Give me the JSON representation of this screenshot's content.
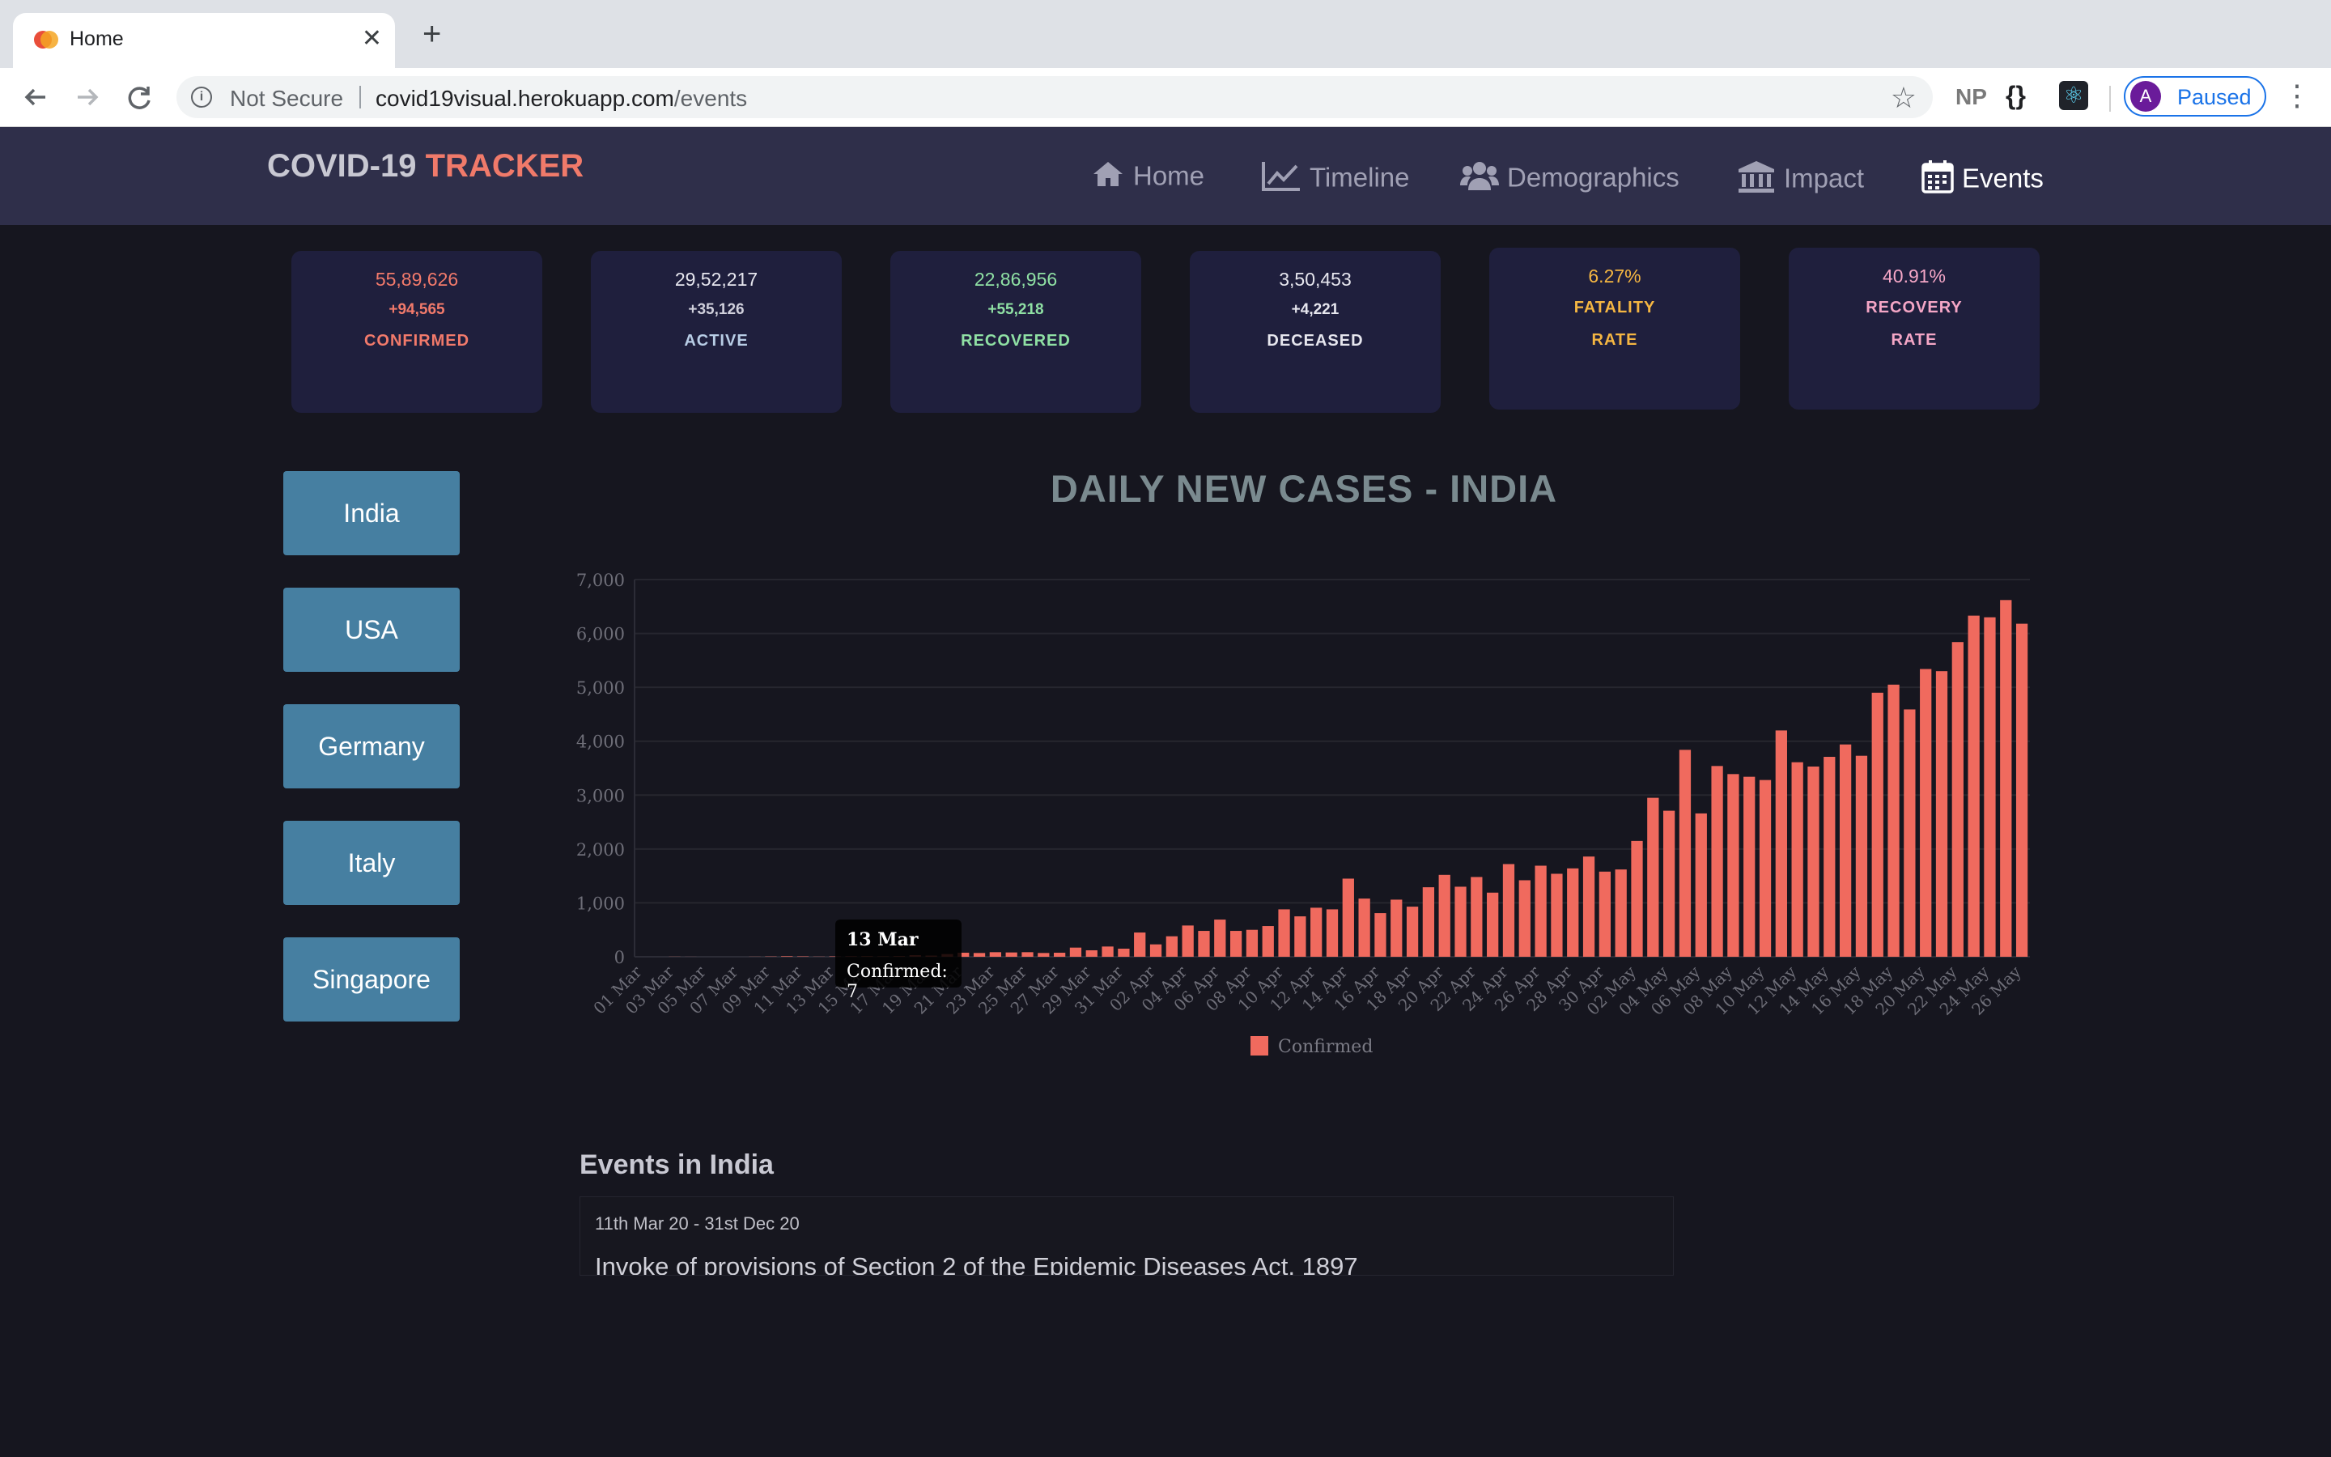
{
  "browser": {
    "tab_title": "Home",
    "new_tab_symbol": "+",
    "close_symbol": "✕",
    "security_label": "Not Secure",
    "url_host": "covid19visual.herokuapp.com",
    "url_path": "/events",
    "extensions": {
      "np": "NP",
      "braces": "{}"
    },
    "profile": {
      "initial": "A",
      "status": "Paused"
    }
  },
  "app": {
    "brand_main": "COVID-19",
    "brand_accent": "TRACKER",
    "nav": [
      {
        "label": "Home",
        "icon": "home-icon"
      },
      {
        "label": "Timeline",
        "icon": "line-chart-icon"
      },
      {
        "label": "Demographics",
        "icon": "users-icon"
      },
      {
        "label": "Impact",
        "icon": "institution-icon"
      },
      {
        "label": "Events",
        "icon": "calendar-icon",
        "active": true
      }
    ]
  },
  "stats": [
    {
      "value": "55,89,626",
      "delta": "+94,565",
      "label": "CONFIRMED",
      "color": "#f27a6b"
    },
    {
      "value": "29,52,217",
      "delta": "+35,126",
      "label": "ACTIVE",
      "color": "#a9c6e6"
    },
    {
      "value": "22,86,956",
      "delta": "+55,218",
      "label": "RECOVERED",
      "color": "#8fe0a4"
    },
    {
      "value": "3,50,453",
      "delta": "+4,221",
      "label": "DECEASED",
      "color": "#e0e0e8"
    },
    {
      "value": "6.27%",
      "label_line1": "FATALITY",
      "label_line2": "RATE",
      "color": "#f5b642"
    },
    {
      "value": "40.91%",
      "label_line1": "RECOVERY",
      "label_line2": "RATE",
      "color": "#f4a6c6"
    }
  ],
  "countries": [
    "India",
    "USA",
    "Germany",
    "Italy",
    "Singapore"
  ],
  "chart": {
    "title": "DAILY NEW CASES - INDIA",
    "tooltip_title": "13 Mar",
    "tooltip_body": "Confirmed: 7"
  },
  "chart_data": {
    "type": "bar",
    "title": "DAILY NEW CASES - INDIA",
    "xlabel": "",
    "ylabel": "",
    "ylim": [
      0,
      7000
    ],
    "yticks": [
      "0",
      "1,000",
      "2,000",
      "3,000",
      "4,000",
      "5,000",
      "6,000",
      "7,000"
    ],
    "grid": true,
    "legend": "bottom",
    "bar_color": "#f06a5e",
    "categories": [
      "01 Mar",
      "02 Mar",
      "03 Mar",
      "04 Mar",
      "05 Mar",
      "06 Mar",
      "07 Mar",
      "08 Mar",
      "09 Mar",
      "10 Mar",
      "11 Mar",
      "12 Mar",
      "13 Mar",
      "14 Mar",
      "15 Mar",
      "16 Mar",
      "17 Mar",
      "18 Mar",
      "19 Mar",
      "20 Mar",
      "21 Mar",
      "22 Mar",
      "23 Mar",
      "24 Mar",
      "25 Mar",
      "26 Mar",
      "27 Mar",
      "28 Mar",
      "29 Mar",
      "30 Mar",
      "31 Mar",
      "01 Apr",
      "02 Apr",
      "03 Apr",
      "04 Apr",
      "05 Apr",
      "06 Apr",
      "07 Apr",
      "08 Apr",
      "09 Apr",
      "10 Apr",
      "11 Apr",
      "12 Apr",
      "13 Apr",
      "14 Apr",
      "15 Apr",
      "16 Apr",
      "17 Apr",
      "18 Apr",
      "19 Apr",
      "20 Apr",
      "21 Apr",
      "22 Apr",
      "23 Apr",
      "24 Apr",
      "25 Apr",
      "26 Apr",
      "27 Apr",
      "28 Apr",
      "29 Apr",
      "30 Apr",
      "01 May",
      "02 May",
      "03 May",
      "04 May",
      "05 May",
      "06 May",
      "07 May",
      "08 May",
      "09 May",
      "10 May",
      "11 May",
      "12 May",
      "13 May",
      "14 May",
      "15 May",
      "16 May",
      "17 May",
      "18 May",
      "19 May",
      "20 May",
      "21 May",
      "22 May",
      "23 May",
      "24 May",
      "25 May",
      "26 May"
    ],
    "tick_labels": [
      "01 Mar",
      "03 Mar",
      "05 Mar",
      "07 Mar",
      "09 Mar",
      "11 Mar",
      "13 Mar",
      "15 Mar",
      "17 Mar",
      "19 Mar",
      "21 Mar",
      "23 Mar",
      "25 Mar",
      "27 Mar",
      "29 Mar",
      "31 Mar",
      "02 Apr",
      "04 Apr",
      "06 Apr",
      "08 Apr",
      "10 Apr",
      "12 Apr",
      "14 Apr",
      "16 Apr",
      "18 Apr",
      "20 Apr",
      "22 Apr",
      "24 Apr",
      "26 Apr",
      "28 Apr",
      "30 Apr",
      "02 May",
      "04 May",
      "06 May",
      "08 May",
      "10 May",
      "12 May",
      "14 May",
      "16 May",
      "18 May",
      "20 May",
      "22 May",
      "24 May",
      "26 May"
    ],
    "series": [
      {
        "name": "Confirmed",
        "values": [
          0,
          0,
          2,
          1,
          0,
          0,
          0,
          2,
          5,
          10,
          7,
          3,
          7,
          10,
          12,
          8,
          13,
          30,
          22,
          50,
          75,
          70,
          85,
          80,
          85,
          70,
          75,
          170,
          120,
          190,
          150,
          450,
          230,
          380,
          580,
          480,
          690,
          480,
          500,
          570,
          880,
          750,
          910,
          880,
          1450,
          1080,
          810,
          1060,
          930,
          1290,
          1520,
          1300,
          1480,
          1190,
          1720,
          1420,
          1690,
          1540,
          1640,
          1860,
          1580,
          1620,
          2150,
          2950,
          2710,
          3840,
          2660,
          3540,
          3390,
          3340,
          3280,
          4200,
          3610,
          3530,
          3710,
          3940,
          3730,
          4900,
          5050,
          4590,
          5340,
          5300,
          5840,
          6330,
          6300,
          6620,
          6180
        ]
      }
    ]
  },
  "events": {
    "title": "Events in India",
    "items": [
      {
        "date": "11th Mar 20 - 31st Dec 20",
        "text": "Invoke of provisions of Section 2 of the Epidemic Diseases Act, 1897"
      }
    ]
  }
}
